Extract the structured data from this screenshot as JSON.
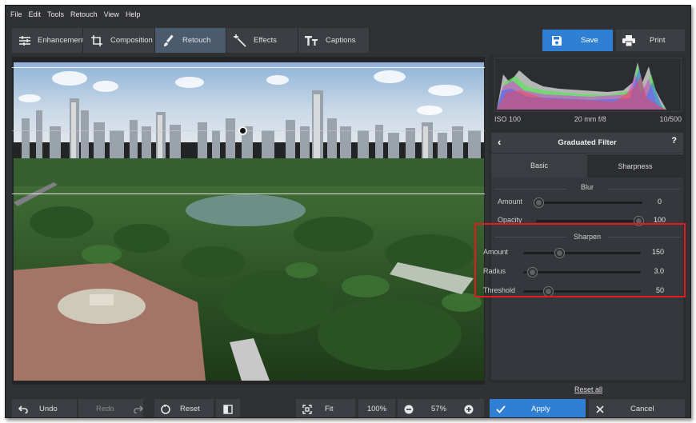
{
  "menu": [
    "File",
    "Edit",
    "Tools",
    "Retouch",
    "View",
    "Help"
  ],
  "toolbar": {
    "tabs": [
      {
        "label": "Enhancement",
        "icon": "sliders-icon"
      },
      {
        "label": "Composition",
        "icon": "crop-icon"
      },
      {
        "label": "Retouch",
        "icon": "brush-icon",
        "active": true
      },
      {
        "label": "Effects",
        "icon": "magic-wand-icon"
      },
      {
        "label": "Captions",
        "icon": "text-icon"
      }
    ],
    "save_label": "Save",
    "print_label": "Print"
  },
  "histogram": {
    "iso": "ISO 100",
    "lens": "20 mm f/8",
    "shutter": "10/500"
  },
  "panel": {
    "title": "Graduated Filter",
    "help": "?",
    "tabs": {
      "basic": "Basic",
      "sharpness": "Sharpness"
    },
    "blur": {
      "title": "Blur",
      "amount": {
        "label": "Amount",
        "value": "0",
        "fraction": 0.0
      },
      "opacity": {
        "label": "Opacity",
        "value": "100",
        "fraction": 1.0
      }
    },
    "sharpen": {
      "title": "Sharpen",
      "amount": {
        "label": "Amount",
        "value": "150",
        "fraction": 0.3
      },
      "radius": {
        "label": "Radius",
        "value": "3.0",
        "fraction": 0.06
      },
      "threshold": {
        "label": "Threshold",
        "value": "50",
        "fraction": 0.2
      }
    },
    "reset_all": "Reset all"
  },
  "bottom": {
    "undo": "Undo",
    "redo": "Redo",
    "reset": "Reset",
    "fit": "Fit",
    "zoom_100": "100%",
    "zoom": "57%",
    "apply": "Apply",
    "cancel": "Cancel"
  },
  "colors": {
    "accent": "#2f7fd4",
    "highlight": "#e21b1b",
    "active_tab": "#4b5b6e"
  }
}
